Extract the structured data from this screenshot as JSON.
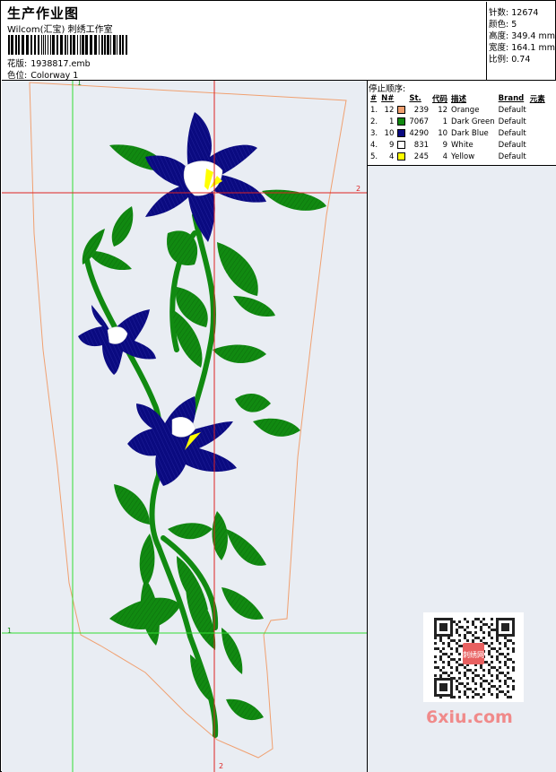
{
  "header": {
    "title": "生产作业图",
    "subtitle": "Wilcom(汇宝) 刺绣工作室",
    "design_label": "花版:",
    "design_value": "1938817.emb",
    "colorway_label": "色位:",
    "colorway_value": "Colorway 1"
  },
  "stats": {
    "stitches_label": "针数:",
    "stitches_value": "12674",
    "colors_label": "颜色:",
    "colors_value": "5",
    "height_label": "高度:",
    "height_value": "349.4 mm",
    "width_label": "宽度:",
    "width_value": "164.1 mm",
    "scale_label": "比例:",
    "scale_value": "0.74"
  },
  "guides": {
    "v1_label": "1",
    "v2_label": "2",
    "h1_label": "1",
    "h2_label": "2"
  },
  "stop_sequence": {
    "title": "停止顺序:",
    "headers": [
      "#",
      "N#",
      "St.",
      "代码",
      "描述",
      "Brand",
      "元素"
    ],
    "rows": [
      {
        "idx": "1.",
        "n": "12",
        "color": "#f0a070",
        "st": "239",
        "code": "12",
        "desc": "Orange",
        "brand": "Default",
        "element": ""
      },
      {
        "idx": "2.",
        "n": "1",
        "color": "#118a11",
        "st": "7067",
        "code": "1",
        "desc": "Dark Green",
        "brand": "Default",
        "element": ""
      },
      {
        "idx": "3.",
        "n": "10",
        "color": "#0a0a80",
        "st": "4290",
        "code": "10",
        "desc": "Dark Blue",
        "brand": "Default",
        "element": ""
      },
      {
        "idx": "4.",
        "n": "9",
        "color": "#ffffff",
        "st": "831",
        "code": "9",
        "desc": "White",
        "brand": "Default",
        "element": ""
      },
      {
        "idx": "5.",
        "n": "4",
        "color": "#ffff00",
        "st": "245",
        "code": "4",
        "desc": "Yellow",
        "brand": "Default",
        "element": ""
      }
    ]
  },
  "watermark": {
    "text": "6xiu.com",
    "badge_text": "刺绣网"
  },
  "colors": {
    "guide_green": "#33dd33",
    "guide_red": "#dd2222",
    "outline_orange": "#f0a070",
    "leaf_green": "#118a11",
    "flower_blue": "#0a0a80",
    "stamen_yellow": "#ffff00",
    "background": "#e9edf3"
  }
}
